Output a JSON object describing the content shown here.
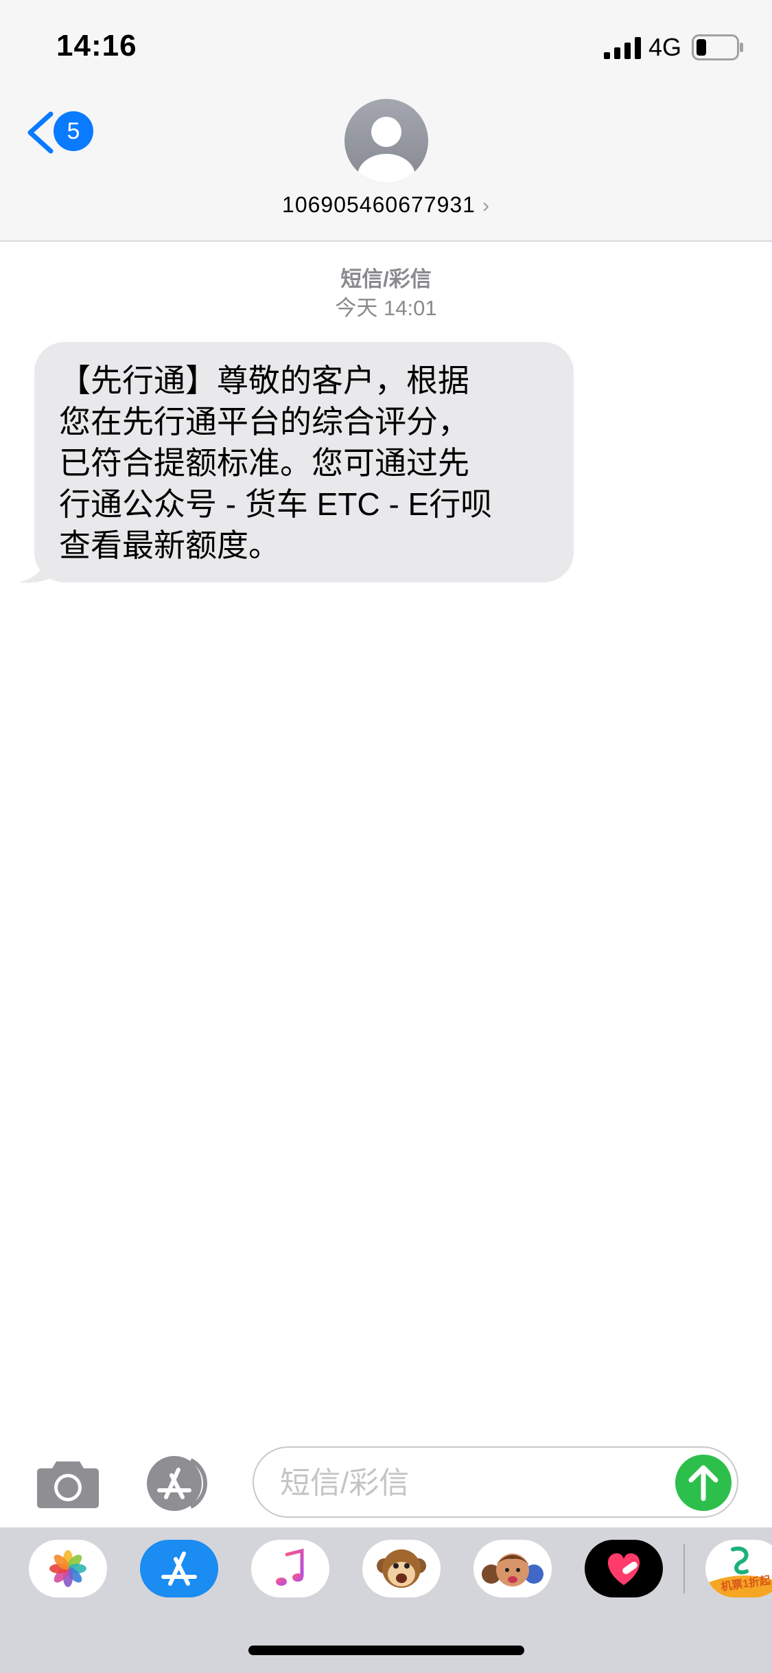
{
  "status_bar": {
    "time": "14:16",
    "network": "4G",
    "battery_level": 0.25
  },
  "header": {
    "back_badge_count": "5",
    "contact_number": "106905460677931",
    "contact_chevron": "›"
  },
  "conversation": {
    "message_kind": "短信/彩信",
    "timestamp": "今天 14:01",
    "messages": [
      {
        "direction": "incoming",
        "text": "【先行通】尊敬的客户，根据\n您在先行通平台的综合评分，\n已符合提额标准。您可通过先\n行通公众号 - 货车 ETC - E行呗\n查看最新额度。"
      }
    ]
  },
  "composer": {
    "placeholder": "短信/彩信",
    "value": ""
  },
  "app_drawer": {
    "apps": [
      {
        "name": "photos-app-icon"
      },
      {
        "name": "app-store-app-icon"
      },
      {
        "name": "music-app-icon"
      },
      {
        "name": "animoji-app-icon"
      },
      {
        "name": "memoji-app-icon"
      },
      {
        "name": "digital-touch-app-icon"
      },
      {
        "name": "trip-app-icon",
        "label": "机票1折起"
      }
    ]
  },
  "colors": {
    "accent": "#0a7aff",
    "send": "#2dbf4c",
    "bubble_incoming": "#e9e9eb",
    "header_bg": "#f6f6f6",
    "drawer_bg": "#d4d5da"
  }
}
